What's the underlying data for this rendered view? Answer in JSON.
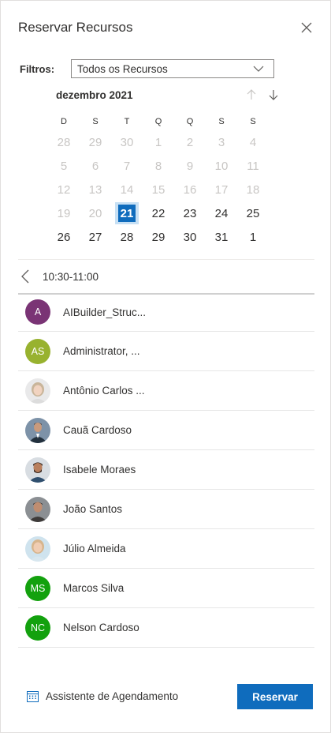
{
  "header": {
    "title": "Reservar Recursos"
  },
  "filters": {
    "label": "Filtros:",
    "value": "Todos os Recursos"
  },
  "calendar": {
    "month": "dezembro 2021",
    "weekdays": [
      "D",
      "S",
      "T",
      "Q",
      "Q",
      "S",
      "S"
    ],
    "weeks": [
      [
        {
          "d": "28",
          "out": true
        },
        {
          "d": "29",
          "out": true
        },
        {
          "d": "30",
          "out": true
        },
        {
          "d": "1",
          "out": true
        },
        {
          "d": "2",
          "out": true
        },
        {
          "d": "3",
          "out": true
        },
        {
          "d": "4",
          "out": true
        }
      ],
      [
        {
          "d": "5",
          "out": true
        },
        {
          "d": "6",
          "out": true
        },
        {
          "d": "7",
          "out": true
        },
        {
          "d": "8",
          "out": true
        },
        {
          "d": "9",
          "out": true
        },
        {
          "d": "10",
          "out": true
        },
        {
          "d": "11",
          "out": true
        }
      ],
      [
        {
          "d": "12",
          "out": true
        },
        {
          "d": "13",
          "out": true
        },
        {
          "d": "14",
          "out": true
        },
        {
          "d": "15",
          "out": true
        },
        {
          "d": "16",
          "out": true
        },
        {
          "d": "17",
          "out": true
        },
        {
          "d": "18",
          "out": true
        }
      ],
      [
        {
          "d": "19",
          "out": true
        },
        {
          "d": "20",
          "out": true
        },
        {
          "d": "21",
          "sel": true
        },
        {
          "d": "22"
        },
        {
          "d": "23"
        },
        {
          "d": "24"
        },
        {
          "d": "25"
        }
      ],
      [
        {
          "d": "26"
        },
        {
          "d": "27"
        },
        {
          "d": "28"
        },
        {
          "d": "29"
        },
        {
          "d": "30"
        },
        {
          "d": "31"
        },
        {
          "d": "1"
        }
      ]
    ]
  },
  "slot": {
    "time": "10:30-11:00"
  },
  "resources": [
    {
      "name": "AIBuilder_Struc...",
      "initials": "A",
      "color": "#7a3475"
    },
    {
      "name": "Administrator, ...",
      "initials": "AS",
      "color": "#98b22f"
    },
    {
      "name": "Antônio Carlos ...",
      "photo": "light-female"
    },
    {
      "name": "Cauã Cardoso",
      "photo": "suit-male"
    },
    {
      "name": "Isabele Moraes",
      "photo": "bearded-male"
    },
    {
      "name": "João Santos",
      "photo": "dark-male"
    },
    {
      "name": "Júlio Almeida",
      "photo": "smiling-female"
    },
    {
      "name": "Marcos Silva",
      "initials": "MS",
      "color": "#13a10e"
    },
    {
      "name": "Nelson Cardoso",
      "initials": "NC",
      "color": "#13a10e"
    }
  ],
  "footer": {
    "assistant_label": "Assistente de Agendamento",
    "reserve_label": "Reservar"
  },
  "colors": {
    "accent": "#0f6cbd",
    "selection_bg": "#c7e0f4"
  }
}
